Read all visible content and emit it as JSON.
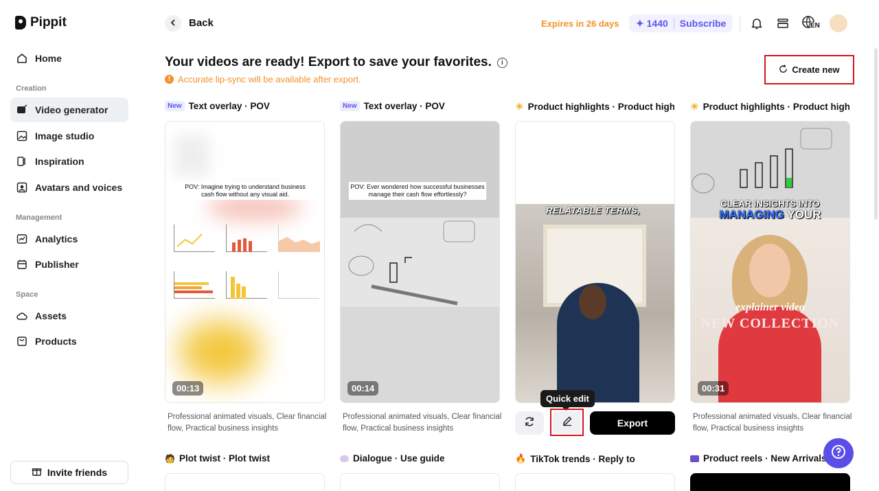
{
  "app": {
    "name": "Pippit"
  },
  "sidebar": {
    "home": "Home",
    "sections": {
      "creation": "Creation",
      "management": "Management",
      "space": "Space"
    },
    "items": {
      "video_generator": "Video generator",
      "image_studio": "Image studio",
      "inspiration": "Inspiration",
      "avatars_voices": "Avatars and voices",
      "analytics": "Analytics",
      "publisher": "Publisher",
      "assets": "Assets",
      "products": "Products"
    },
    "invite": "Invite friends"
  },
  "topbar": {
    "back": "Back",
    "expires": "Expires in 26 days",
    "credits": "1440",
    "subscribe": "Subscribe",
    "language": "EN"
  },
  "main": {
    "heading": "Your videos are ready! Export to save your favorites.",
    "info_icon": "i",
    "notice": "Accurate lip-sync will be available after export.",
    "notice_icon": "!",
    "create_new": "Create new"
  },
  "cards": [
    {
      "badge": "New",
      "title": "Text overlay · POV",
      "duration": "00:13",
      "caption": "POV: Imagine trying to understand business cash flow without any visual aid.",
      "description": "Professional animated visuals, Clear financial flow, Practical business insights"
    },
    {
      "badge": "New",
      "title": "Text overlay · POV",
      "duration": "00:14",
      "caption": "POV: Ever wondered how successful businesses manage their cash flow effortlessly?",
      "description": "Professional animated visuals, Clear financial flow, Practical business insights"
    },
    {
      "title": "Product highlights · Product high...",
      "overlay_text": "RELATABLE TERMS,"
    },
    {
      "title": "Product highlights · Product high...",
      "duration": "00:31",
      "overlay_line1": "CLEAR INSIGHTS INTO",
      "overlay_line2a": "MANAGING",
      "overlay_line2b": "YOUR",
      "overlay_line3": "explainer video",
      "overlay_line4": "NEW COLLECTION",
      "description": "Professional animated visuals, Clear financial flow, Practical business insights"
    }
  ],
  "card3_actions": {
    "tooltip": "Quick edit",
    "export": "Export"
  },
  "row2": [
    {
      "title": "Plot twist · Plot twist"
    },
    {
      "title": "Dialogue · Use guide"
    },
    {
      "title": "TikTok trends · Reply to"
    },
    {
      "title": "Product reels · New Arrivals"
    }
  ],
  "colors": {
    "accent": "#5b56e8",
    "warning": "#f2922b",
    "highlight_box": "#d6141e"
  }
}
